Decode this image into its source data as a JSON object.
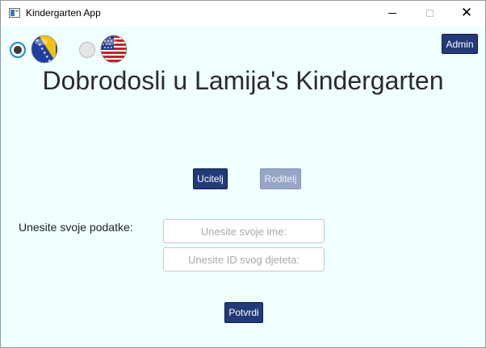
{
  "window": {
    "title": "Kindergarten App",
    "icons": {
      "app": "app-window-icon",
      "minimize": "minimize-icon",
      "maximize": "maximize-icon",
      "close": "close-icon"
    }
  },
  "language": {
    "options": [
      {
        "code": "bs",
        "flag_icon": "bosnia-flag-icon",
        "selected": true
      },
      {
        "code": "en",
        "flag_icon": "usa-flag-icon",
        "selected": false
      }
    ]
  },
  "header": {
    "admin_label": "Admin",
    "welcome": "Dobrodosli u Lamija's Kindergarten"
  },
  "roles": {
    "teacher_label": "Ucitelj",
    "parent_label": "Roditelj",
    "parent_enabled": false
  },
  "form": {
    "label": "Unesite svoje podatke:",
    "name_placeholder": "Unesite svoje ime:",
    "name_value": "",
    "id_placeholder": "Unesite ID svog djeteta:",
    "id_value": "",
    "submit_label": "Potvrdi"
  },
  "colors": {
    "background": "#f0ffff",
    "primary_button": "#223a78",
    "disabled_button": "#97a6c6"
  }
}
